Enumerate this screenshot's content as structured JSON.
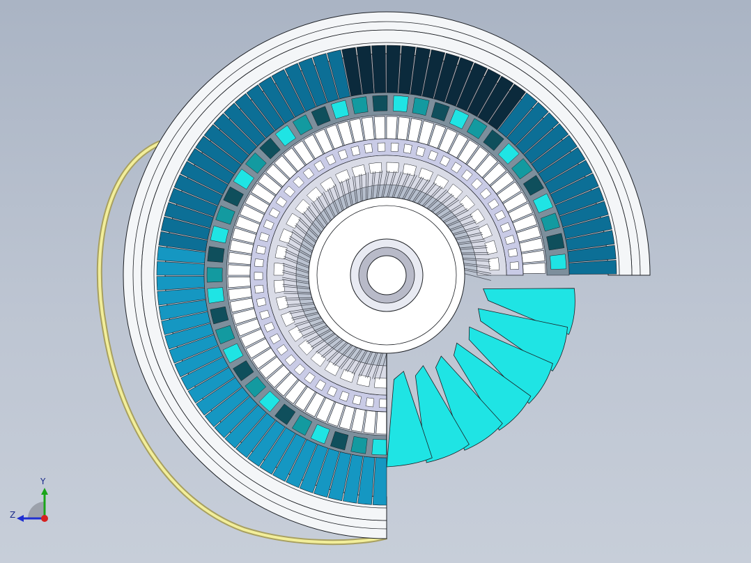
{
  "viewport": {
    "background_top": "#aab4c4",
    "background_bottom": "#c7ced9"
  },
  "model": {
    "part_name": "turbine-stator-assembly-section",
    "colors": {
      "blade_dark": "#0b2a3c",
      "blade_mid": "#0c6f96",
      "blade_light": "#1597c2",
      "cyan": "#1fe4e4",
      "casing": "#f4f6f8",
      "edge": "#1c1f24",
      "hub": "#e8eaf2",
      "lavender": "#c9cbe6",
      "cable": "#f2ee9a"
    }
  },
  "triad": {
    "y_label": "Y",
    "z_label": "Z",
    "x_color": "#d62020",
    "y_color": "#1aa51a",
    "z_color": "#1f2fd1"
  }
}
